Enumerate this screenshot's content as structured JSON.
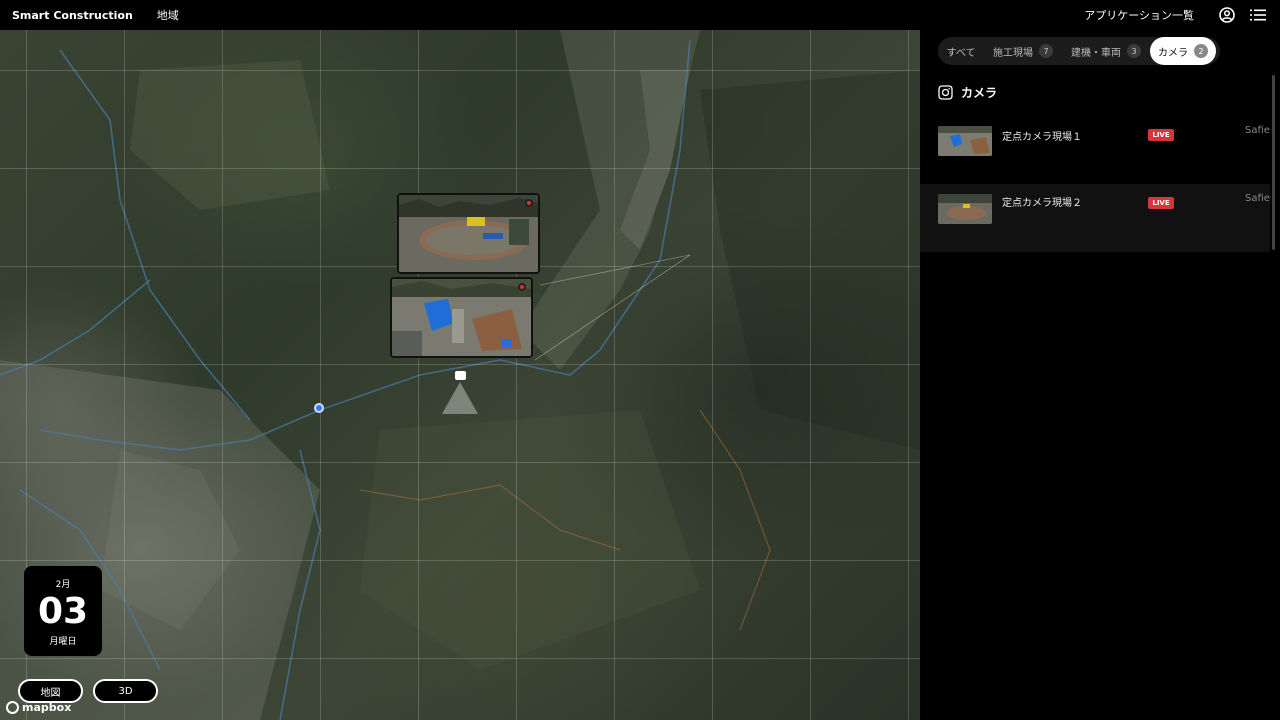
{
  "header": {
    "brand": "Smart Construction",
    "region": "地域",
    "apps": "アプリケーション一覧",
    "icons": [
      "account-circle-icon",
      "menu-list-icon"
    ]
  },
  "date": {
    "month": "2月",
    "day": "03",
    "weekday": "月曜日"
  },
  "map_controls": {
    "map_label": "地図",
    "three_d_label": "3D",
    "attribution": "mapbox"
  },
  "panel": {
    "tabs": [
      {
        "label": "すべて",
        "count": ""
      },
      {
        "label": "施工現場",
        "count": "7"
      },
      {
        "label": "建機・車両",
        "count": "3"
      },
      {
        "label": "カメラ",
        "count": "2"
      }
    ],
    "active_tab": "カメラ",
    "section_title": "カメラ",
    "cameras": [
      {
        "name": "定点カメラ現場１",
        "status": "LIVE",
        "provider": "Safie"
      },
      {
        "name": "定点カメラ現場２",
        "status": "LIVE",
        "provider": "Safie"
      }
    ]
  },
  "colors": {
    "live": "#d8343c",
    "marker": "#3a78ff",
    "background": "#000000"
  }
}
